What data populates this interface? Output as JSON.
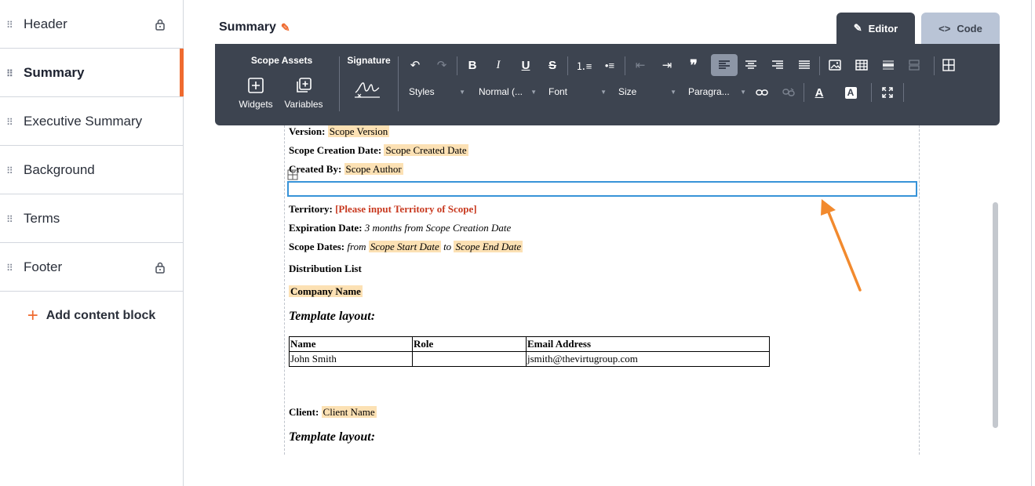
{
  "sidebar": {
    "items": [
      {
        "label": "Header",
        "locked": true,
        "active": false
      },
      {
        "label": "Summary",
        "locked": false,
        "active": true
      },
      {
        "label": "Executive Summary",
        "locked": false,
        "active": false
      },
      {
        "label": "Background",
        "locked": false,
        "active": false
      },
      {
        "label": "Terms",
        "locked": false,
        "active": false
      },
      {
        "label": "Footer",
        "locked": true,
        "active": false
      }
    ],
    "add_block": "Add content block"
  },
  "editor": {
    "title": "Summary",
    "tabs": {
      "editor": "Editor",
      "code": "Code"
    },
    "toolbar": {
      "scope_assets": "Scope Assets",
      "widgets": "Widgets",
      "variables": "Variables",
      "signature": "Signature",
      "styles": "Styles",
      "format": "Normal (...",
      "font": "Font",
      "size": "Size",
      "paragraph": "Paragra..."
    }
  },
  "document": {
    "version_label": "Version:",
    "version_value": "Scope Version",
    "creation_label": "Scope Creation Date:",
    "creation_value": "Scope Created Date",
    "created_by_label": "Created By:",
    "created_by_value": "Scope Author",
    "territory_label": "Territory:",
    "territory_value": "[Please input Territory of Scope]",
    "expiration_label": "Expiration Date:",
    "expiration_value": "3 months from Scope Creation Date",
    "scope_dates_label": "Scope Dates:",
    "scope_dates_from": "from",
    "scope_start": "Scope Start Date",
    "scope_dates_to": "to",
    "scope_end": "Scope End Date",
    "distribution_list": "Distribution List",
    "company_name": "Company Name",
    "template_layout": "Template layout:",
    "table_headers": [
      "Name",
      "Role",
      "Email Address"
    ],
    "table_rows": [
      [
        "John Smith",
        "",
        "jsmith@thevirtugroup.com"
      ]
    ],
    "client_label": "Client:",
    "client_value": "Client Name",
    "template_layout_2": "Template layout:"
  },
  "colors": {
    "accent": "#ef6a2f",
    "toolbar_bg": "#3d4450",
    "highlight": "#fce1b4",
    "selection": "#3793d8",
    "callout_arrow": "#f28a2e"
  }
}
